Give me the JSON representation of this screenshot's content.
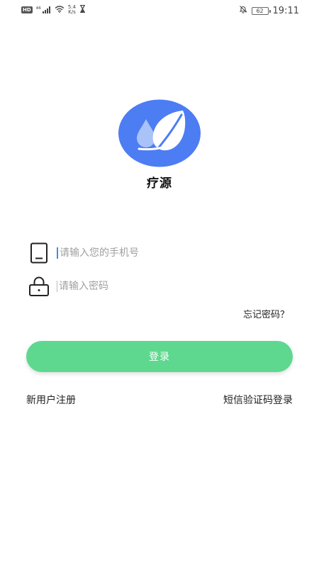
{
  "status_bar": {
    "hd_badge": "HD",
    "signal_label": "⁴⁶",
    "net_speed_value": "5.4",
    "net_speed_unit": "K/s",
    "battery_level": "62",
    "time": "19:11"
  },
  "app": {
    "name": "疗源",
    "logo_color": "#4d7df3"
  },
  "login_form": {
    "phone_placeholder": "请输入您的手机号",
    "password_placeholder": "请输入密码",
    "forgot_password": "忘记密码？",
    "login_button": "登录",
    "login_button_color": "#5fd88f"
  },
  "footer_links": {
    "register": "新用户注册",
    "sms_login": "短信验证码登录"
  }
}
